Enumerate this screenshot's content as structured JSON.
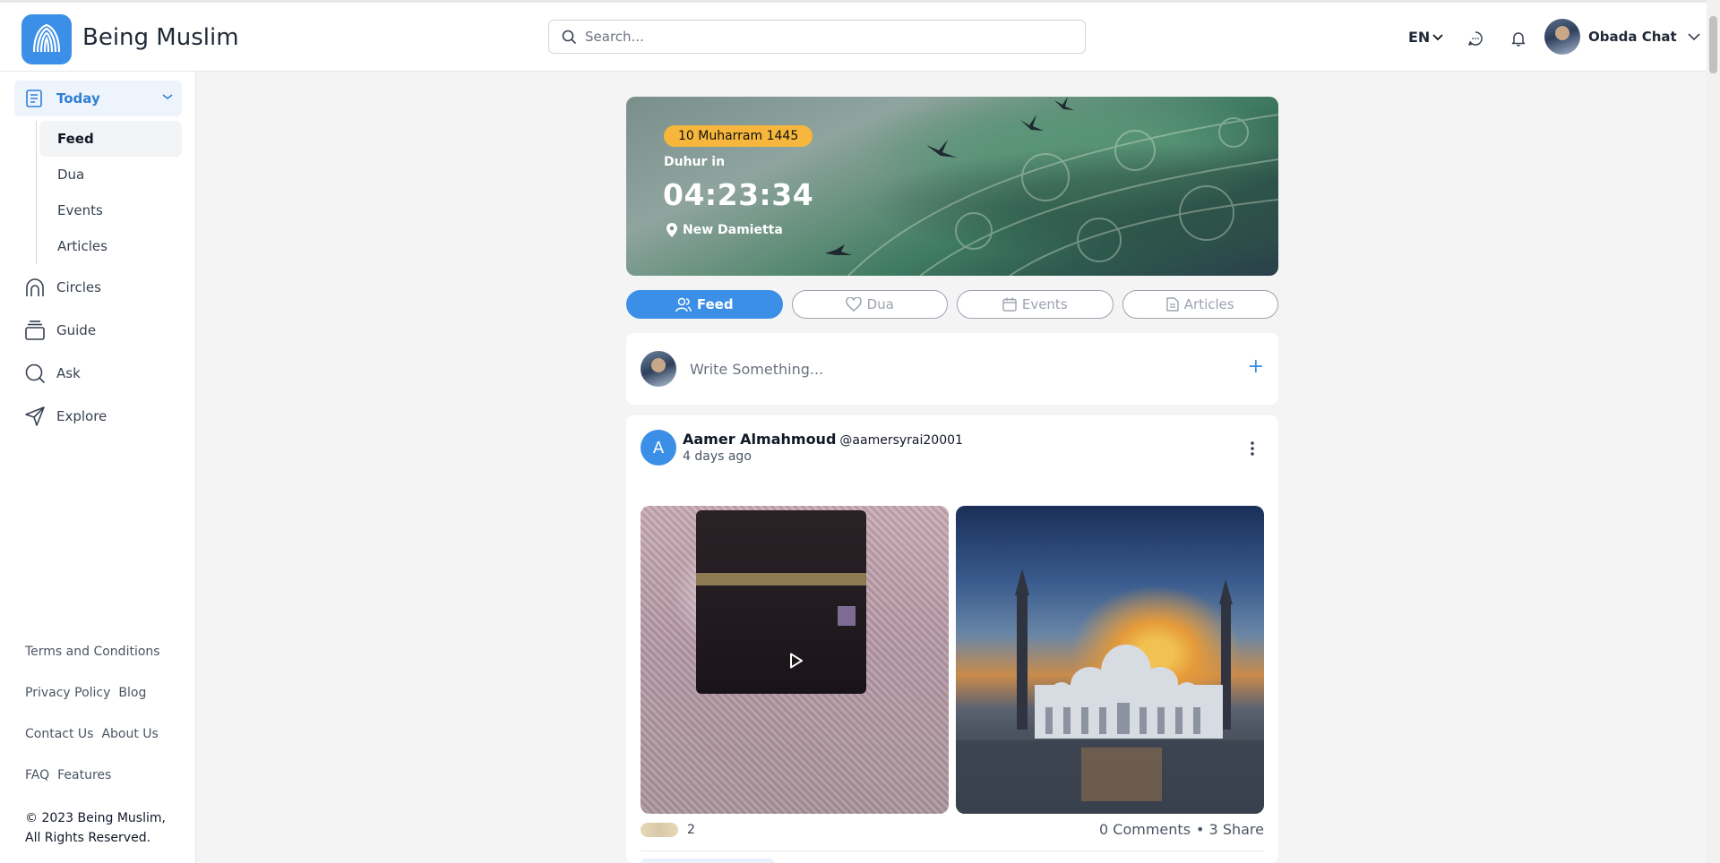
{
  "app": {
    "name": "Being Muslim"
  },
  "header": {
    "search_placeholder": "Search...",
    "language": "EN",
    "user_name": "Obada Chat"
  },
  "sidebar": {
    "today_label": "Today",
    "sub_items": [
      "Feed",
      "Dua",
      "Events",
      "Articles"
    ],
    "active_sub_item": "Feed",
    "nav_items": [
      "Circles",
      "Guide",
      "Ask",
      "Explore"
    ],
    "footer_links": [
      [
        "Terms and Conditions"
      ],
      [
        "Privacy Policy",
        "Blog"
      ],
      [
        "Contact Us",
        "About Us"
      ],
      [
        "FAQ",
        "Features"
      ]
    ],
    "copyright": "© 2023 Being Muslim, All Rights Reserved."
  },
  "hero": {
    "hijri_date": "10 Muharram 1445",
    "next_prayer": "Duhur in",
    "countdown": "04:23:34",
    "location": "New Damietta"
  },
  "tabs": [
    {
      "label": "Feed",
      "icon": "users-icon",
      "active": true
    },
    {
      "label": "Dua",
      "icon": "heart-icon",
      "active": false
    },
    {
      "label": "Events",
      "icon": "calendar-icon",
      "active": false
    },
    {
      "label": "Articles",
      "icon": "document-icon",
      "active": false
    }
  ],
  "composer": {
    "placeholder": "Write Something..."
  },
  "post": {
    "avatar_initial": "A",
    "author": "Aamer Almahmoud",
    "handle": "@aamersyrai20001",
    "time": "4 days ago",
    "reaction_count": "2",
    "comments": "0 Comments",
    "shares": "• 3 Share"
  },
  "colors": {
    "accent": "#3b8fe6",
    "badge": "#f6b73c",
    "active_nav_bg": "#eef4fc"
  }
}
